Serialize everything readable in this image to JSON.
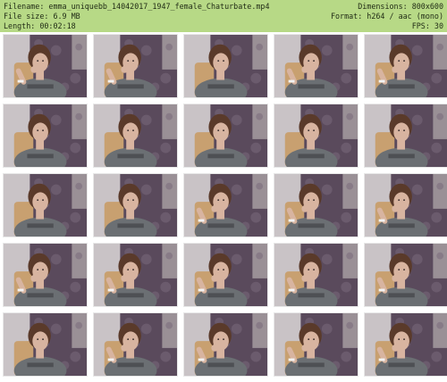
{
  "info": {
    "filename": "Filename: emma_uniquebb_14042017_1947_female_Chaturbate.mp4",
    "filesize": "File size: 6.9 MB",
    "length": "Length: 00:02:18",
    "dimensions": "Dimensions: 800x600",
    "format": "Format: h264 / aac (mono)",
    "fps": "FPS: 30"
  },
  "colors": {
    "header_bg": "#b7d986",
    "wall": "#5a4a5c",
    "wall_light": "#c9c3c6",
    "shirt": "#6b6f73",
    "hair": "#5a3a2a",
    "skin": "#d8b4a0",
    "chair": "#c8a070"
  },
  "thumbnails": [
    {
      "pose": "hand"
    },
    {
      "pose": "hand"
    },
    {
      "pose": "neutral"
    },
    {
      "pose": "hand"
    },
    {
      "pose": "hand"
    },
    {
      "pose": "neutral"
    },
    {
      "pose": "neutral"
    },
    {
      "pose": "neutral"
    },
    {
      "pose": "neutral"
    },
    {
      "pose": "neutral"
    },
    {
      "pose": "neutral"
    },
    {
      "pose": "neutral"
    },
    {
      "pose": "hand"
    },
    {
      "pose": "hand"
    },
    {
      "pose": "hand"
    },
    {
      "pose": "hand"
    },
    {
      "pose": "hand"
    },
    {
      "pose": "hand"
    },
    {
      "pose": "hand"
    },
    {
      "pose": "hand"
    },
    {
      "pose": "neutral"
    },
    {
      "pose": "hand"
    },
    {
      "pose": "hand"
    },
    {
      "pose": "hand"
    },
    {
      "pose": "hand"
    }
  ]
}
